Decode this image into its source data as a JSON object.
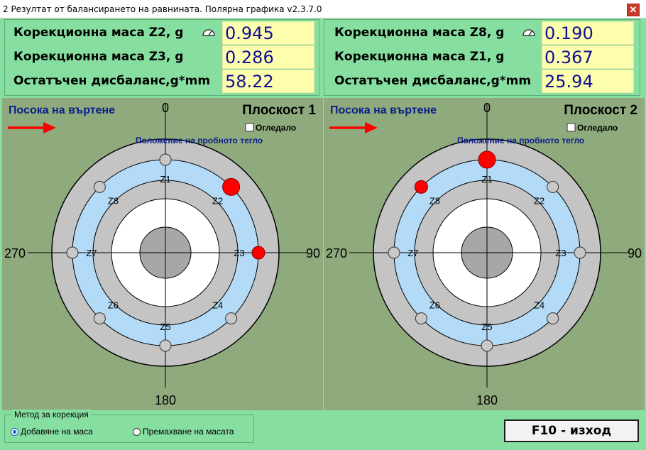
{
  "window": {
    "title": "2 Резултат от балансирането на равнината. Полярна графика v2.3.7.0",
    "close_label": "✕"
  },
  "info": [
    {
      "rows": [
        {
          "label": "Корекционна маса Z2, g",
          "value": "0.945",
          "has_icon": true
        },
        {
          "label": "Корекционна маса Z3, g",
          "value": "0.286"
        },
        {
          "label": "Остатъчен дисбаланс,g*mm",
          "value": "58.22"
        }
      ]
    },
    {
      "rows": [
        {
          "label": "Корекционна маса Z8, g",
          "value": "0.190",
          "has_icon": true
        },
        {
          "label": "Корекционна маса Z1, g",
          "value": "0.367"
        },
        {
          "label": "Остатъчен дисбаланс,g*mm",
          "value": "25.94"
        }
      ]
    }
  ],
  "plots": [
    {
      "rotation_label": "Посока на въртене",
      "plane_title": "Плоскост 1",
      "mirror_label": "Огледало",
      "trial_label": "Положение на пробното тегло",
      "angle_labels": {
        "top": "0",
        "right": "90",
        "bottom": "180",
        "left": "270"
      },
      "zones": [
        "Z1",
        "Z2",
        "Z3",
        "Z4",
        "Z5",
        "Z6",
        "Z7",
        "Z8"
      ],
      "red_markers": [
        {
          "zone_angle": 45,
          "size": "large"
        },
        {
          "zone_angle": 90,
          "size": "small"
        }
      ]
    },
    {
      "rotation_label": "Посока на въртене",
      "plane_title": "Плоскост 2",
      "mirror_label": "Огледало",
      "trial_label": "Положение на пробното тегло",
      "angle_labels": {
        "top": "0",
        "right": "90",
        "bottom": "180",
        "left": "270"
      },
      "zones": [
        "Z1",
        "Z2",
        "Z3",
        "Z4",
        "Z5",
        "Z6",
        "Z7",
        "Z8"
      ],
      "red_markers": [
        {
          "zone_angle": 0,
          "size": "large"
        },
        {
          "zone_angle": 315,
          "size": "small"
        }
      ]
    }
  ],
  "method": {
    "title": "Метод за корекция",
    "options": [
      {
        "label": "Добавяне на маса",
        "selected": true
      },
      {
        "label": "Премахване на масата",
        "selected": false
      }
    ]
  },
  "exit_label": "F10 - изход",
  "colors": {
    "panel_green": "#86dfa0",
    "plot_bg": "#8fab7e",
    "ring_gray": "#c4c4c4",
    "ring_blue": "#b3daf6",
    "marker_red": "#ff0000",
    "value_bg": "#fdfdae",
    "value_text": "#101090",
    "title_blue": "#0c1e8a"
  }
}
